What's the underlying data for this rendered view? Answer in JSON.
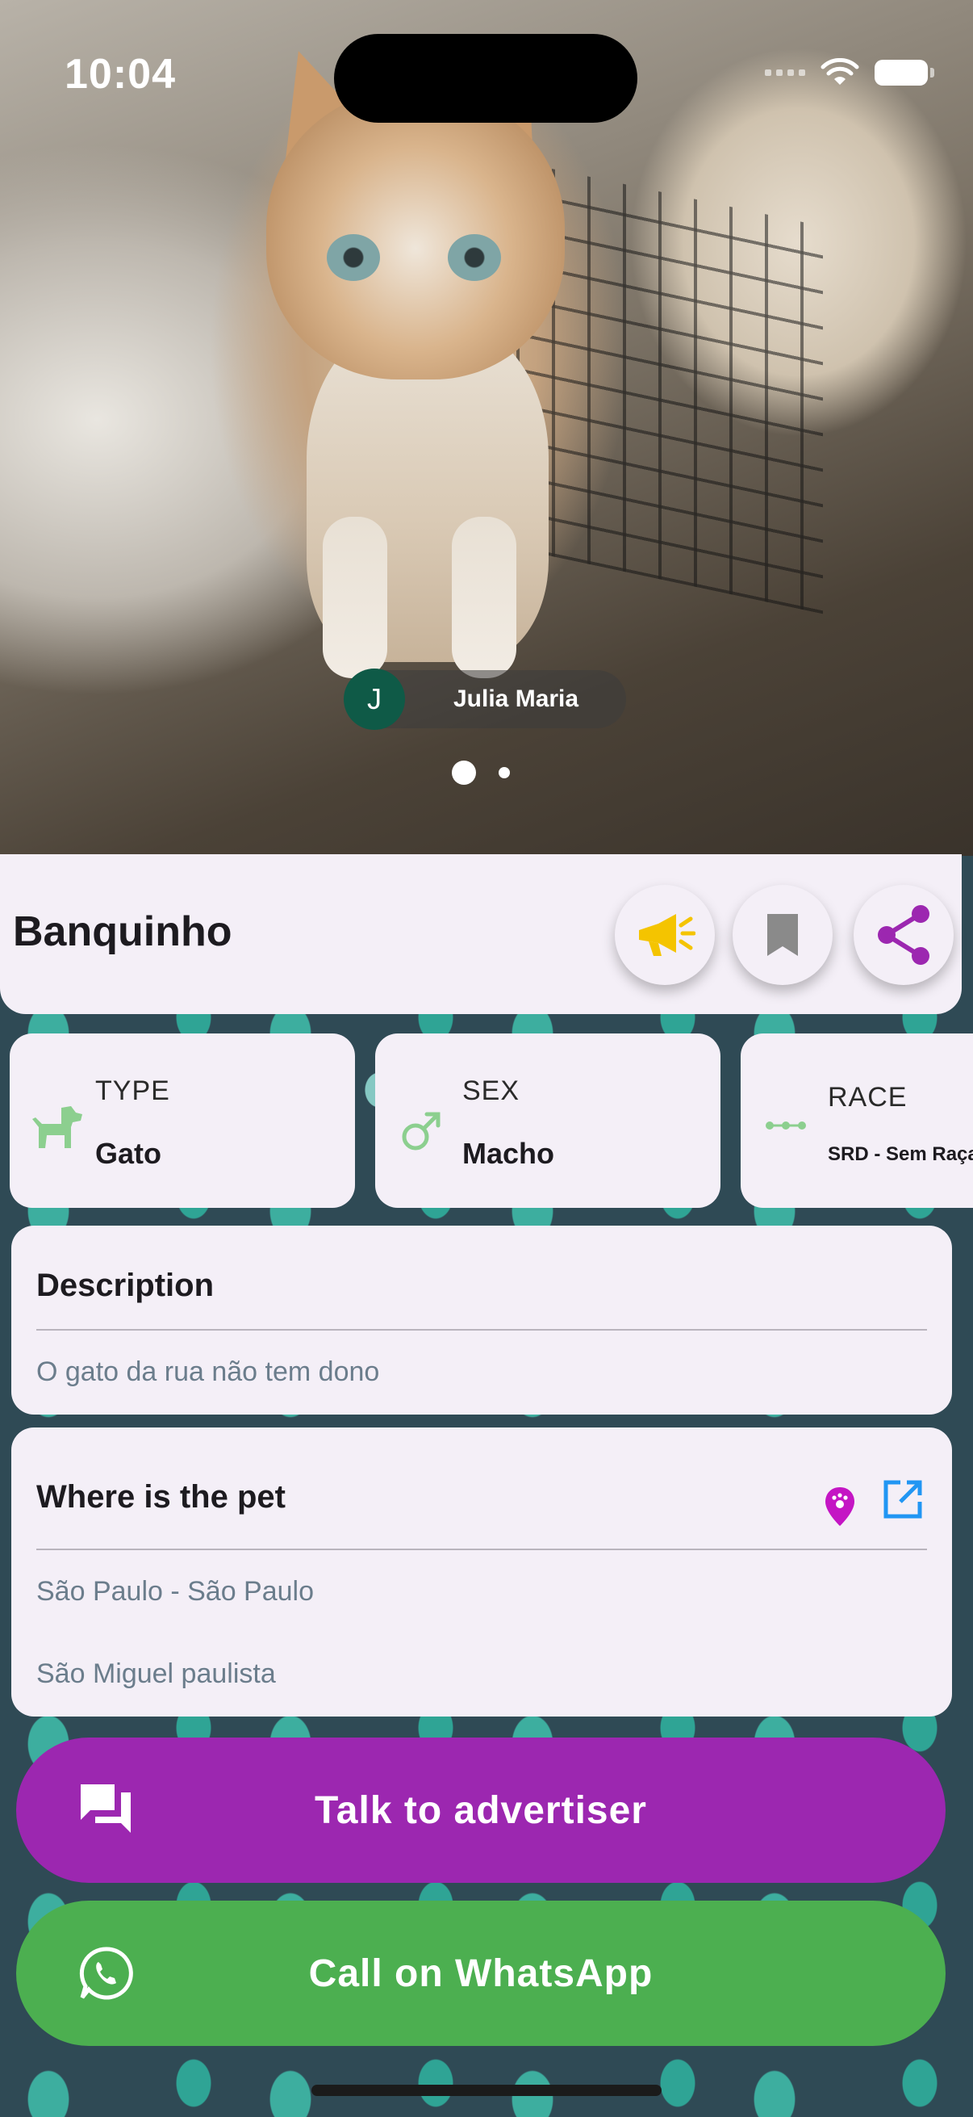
{
  "status_bar": {
    "time": "10:04"
  },
  "hero": {
    "author_initial": "J",
    "author_name": "Julia Maria",
    "image_count": 2,
    "active_image": 1
  },
  "pet": {
    "name": "Banquinho",
    "actions": [
      {
        "icon": "megaphone-icon",
        "color": "#f4c400"
      },
      {
        "icon": "bookmark-icon",
        "color": "#8a8a8a"
      },
      {
        "icon": "share-icon",
        "color": "#9c27b0"
      }
    ]
  },
  "attributes": [
    {
      "label": "TYPE",
      "value": "Gato",
      "icon": "dog-icon"
    },
    {
      "label": "SEX",
      "value": "Macho",
      "icon": "male-icon"
    },
    {
      "label": "RACE",
      "value": "SRD - Sem Raça",
      "icon": "dna-icon"
    }
  ],
  "description": {
    "title": "Description",
    "text": "O gato da rua não tem dono"
  },
  "location": {
    "title": "Where is the pet",
    "line1": "São Paulo - São Paulo",
    "line2": "São Miguel paulista"
  },
  "buttons": {
    "talk": {
      "label": "Talk to advertiser",
      "color": "#9c27b0"
    },
    "whatsapp": {
      "label": "Call on WhatsApp",
      "color": "#4caf50"
    }
  },
  "colors": {
    "card_bg": "#f4eff7",
    "accent_purple": "#9c27b0",
    "accent_green": "#4caf50",
    "icon_green": "#8ccf8f"
  }
}
